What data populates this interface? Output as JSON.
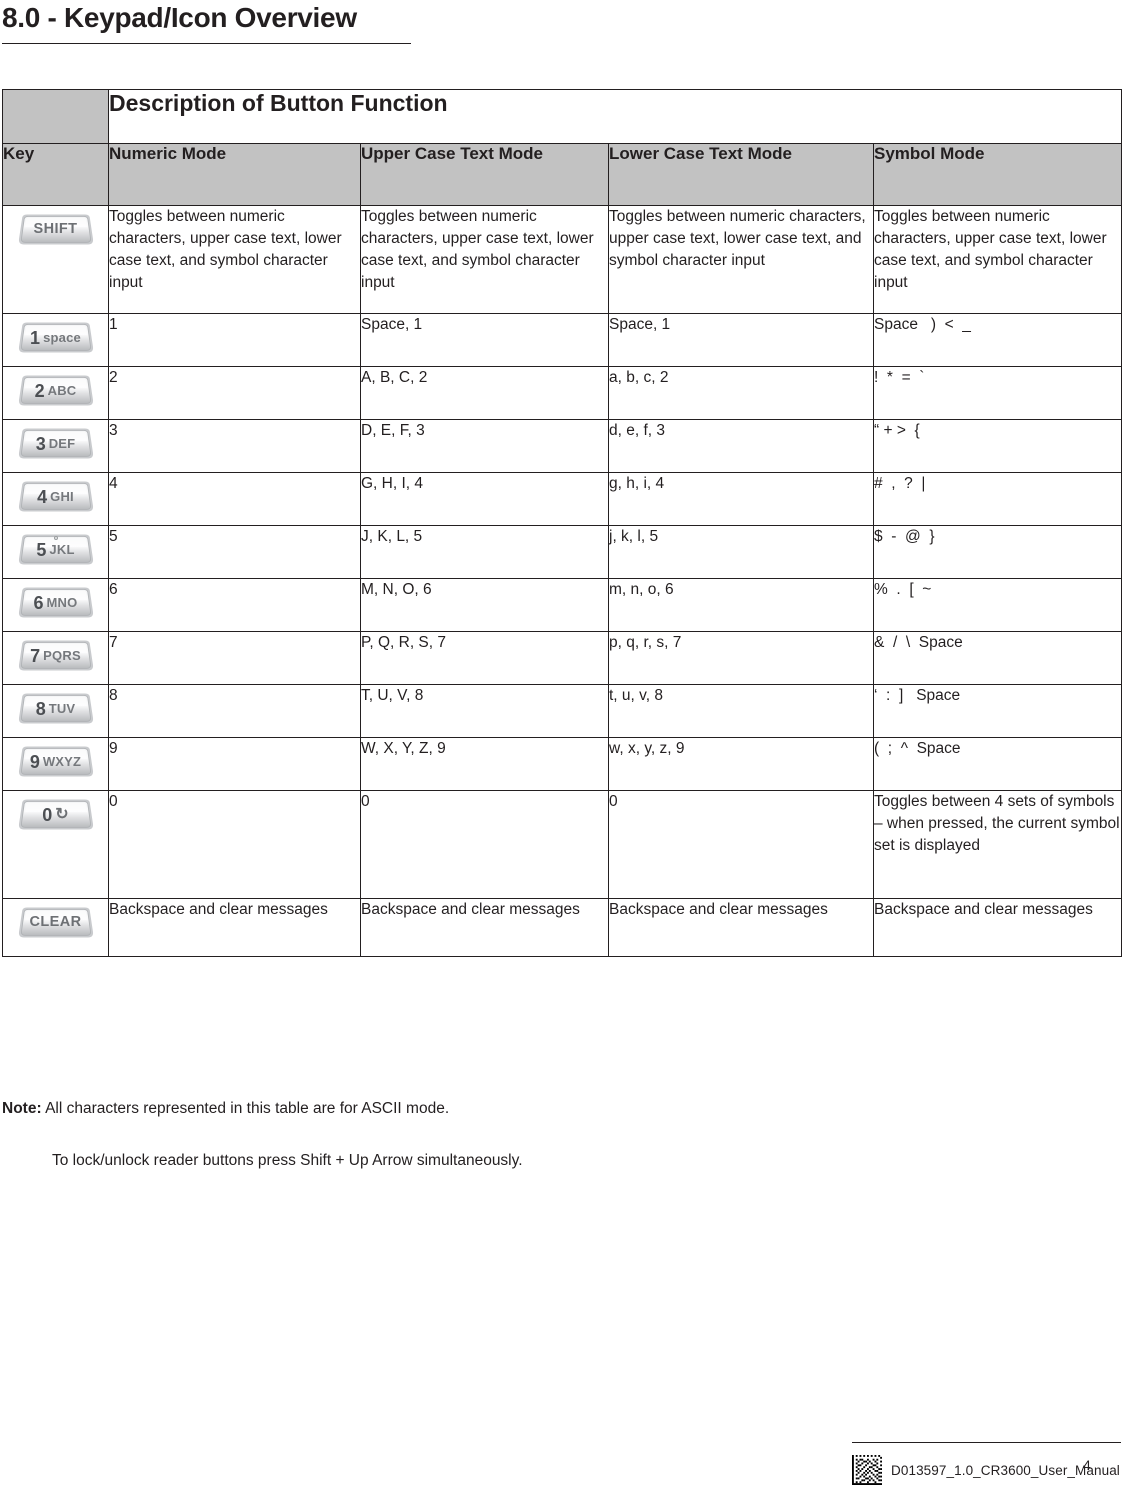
{
  "document": {
    "title": "8.0 - Keypad/Icon Overview"
  },
  "table": {
    "super_header": "Description of Button Function",
    "columns": [
      "Key",
      "Numeric Mode",
      "Upper Case Text Mode",
      "Lower Case Text Mode",
      "Symbol Mode"
    ],
    "rows": [
      {
        "key": {
          "type": "word",
          "word": "SHIFT",
          "digit": "",
          "letters": "",
          "dot": false
        },
        "numeric": "Toggles between numeric characters, upper case text, lower case text, and symbol character input",
        "upper": "Toggles between numeric characters, upper case text, lower case text, and symbol character input",
        "lower": "Toggles between numeric characters, upper case text, lower case text, and symbol character input",
        "symbol": "Toggles between numeric characters, upper case text, lower case text, and symbol character input"
      },
      {
        "key": {
          "type": "digit",
          "digit": "1",
          "letters": "space",
          "word": "",
          "dot": false
        },
        "numeric": "1",
        "upper": "Space, 1",
        "lower": "Space, 1",
        "symbol": "Space   )  <  _"
      },
      {
        "key": {
          "type": "digit",
          "digit": "2",
          "letters": "ABC",
          "word": "",
          "dot": false
        },
        "numeric": "2",
        "upper": "A, B, C, 2",
        "lower": "a, b, c, 2",
        "symbol": "!  *  =  `"
      },
      {
        "key": {
          "type": "digit",
          "digit": "3",
          "letters": "DEF",
          "word": "",
          "dot": false
        },
        "numeric": "3",
        "upper": "D, E, F, 3",
        "lower": "d, e, f, 3",
        "symbol": "“ + >  {"
      },
      {
        "key": {
          "type": "digit",
          "digit": "4",
          "letters": "GHI",
          "word": "",
          "dot": false
        },
        "numeric": "4",
        "upper": "G, H, I, 4",
        "lower": "g, h, i, 4",
        "symbol": "#  ,  ?  |"
      },
      {
        "key": {
          "type": "digit",
          "digit": "5",
          "letters": "JKL",
          "word": "",
          "dot": true
        },
        "numeric": "5",
        "upper": "J, K, L, 5",
        "lower": "j, k, l, 5",
        "symbol": "$  -  @  }"
      },
      {
        "key": {
          "type": "digit",
          "digit": "6",
          "letters": "MNO",
          "word": "",
          "dot": false
        },
        "numeric": "6",
        "upper": "M, N, O, 6",
        "lower": "m, n, o, 6",
        "symbol": "%  .  [  ~"
      },
      {
        "key": {
          "type": "digit",
          "digit": "7",
          "letters": "PQRS",
          "word": "",
          "dot": false
        },
        "numeric": "7",
        "upper": "P, Q, R, S, 7",
        "lower": "p, q, r, s, 7",
        "symbol": "&  /  \\  Space"
      },
      {
        "key": {
          "type": "digit",
          "digit": "8",
          "letters": "TUV",
          "word": "",
          "dot": false
        },
        "numeric": "8",
        "upper": "T, U, V, 8",
        "lower": "t, u, v, 8",
        "symbol": "‘  :  ]   Space"
      },
      {
        "key": {
          "type": "digit",
          "digit": "9",
          "letters": "WXYZ",
          "word": "",
          "dot": false
        },
        "numeric": "9",
        "upper": "W, X, Y, Z, 9",
        "lower": "w, x, y, z, 9",
        "symbol": "(  ;  ^  Space"
      },
      {
        "key": {
          "type": "digit-glyph",
          "digit": "0",
          "letters": "",
          "glyph": "↻",
          "word": "",
          "dot": false
        },
        "numeric": "0",
        "upper": "0",
        "lower": "0",
        "symbol": "Toggles between 4 sets of symbols – when pressed, the current symbol set is displayed"
      },
      {
        "key": {
          "type": "word",
          "word": "CLEAR",
          "digit": "",
          "letters": "",
          "dot": false
        },
        "numeric": "Backspace and clear messages",
        "upper": "Backspace and clear messages",
        "lower": "Backspace and clear messages",
        "symbol": "Backspace and clear messages"
      }
    ]
  },
  "notes": {
    "label": "Note:",
    "line1": "All characters represented in this table are for ASCII mode.",
    "line2": "To lock/unlock reader buttons press Shift + Up Arrow simultaneously."
  },
  "footer": {
    "doc_id": "D013597_1.0_CR3600_User_Manual",
    "page_number": "4",
    "barcode_type": "datamatrix-barcode"
  },
  "colors": {
    "header_band": "#c2c2c2",
    "text": "#231f20",
    "rule": "#231f20"
  }
}
